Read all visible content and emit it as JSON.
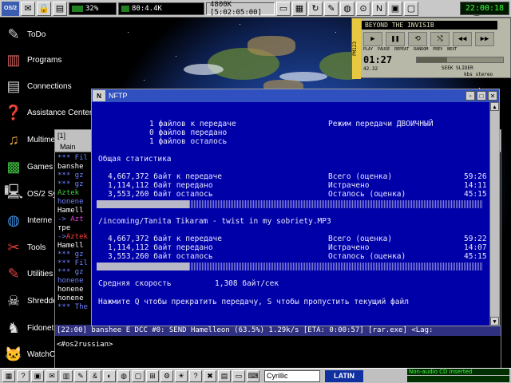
{
  "topbar": {
    "cpu_label": "32%",
    "net_label": "80:4.4K",
    "mem_label": "4800K [5:02:05:00]",
    "clock": "22:00:18"
  },
  "desktop_icons": [
    {
      "label": "ToDo",
      "icon": "todo-icon"
    },
    {
      "label": "Programs",
      "icon": "programs-icon"
    },
    {
      "label": "Connections",
      "icon": "connections-icon"
    },
    {
      "label": "Assistance Center",
      "icon": "assistance-icon"
    },
    {
      "label": "Multime",
      "icon": "multimedia-icon"
    },
    {
      "label": "Games",
      "icon": "games-icon"
    },
    {
      "label": "OS/2 Sy",
      "icon": "os2-system-icon"
    },
    {
      "label": "Interne",
      "icon": "internet-icon"
    },
    {
      "label": "Tools",
      "icon": "tools-icon"
    },
    {
      "label": "Utilities",
      "icon": "utilities-icon"
    },
    {
      "label": "Shredde",
      "icon": "shredder-icon"
    },
    {
      "label": "Fidonet",
      "icon": "fidonet-icon"
    },
    {
      "label": "WatchCat",
      "icon": "watchcat-icon"
    }
  ],
  "player": {
    "title": "BEYOND THE INVISIB",
    "side_tag": "PM123",
    "controls": [
      "▶",
      "❚❚",
      "⟲",
      "⤭",
      "◀◀",
      "▶▶"
    ],
    "control_labels": [
      "PLAY",
      "PAUSE",
      "REPEAT",
      "RANDOM",
      "PREV",
      "NEXT"
    ],
    "time": "01:27",
    "sub": "42.32",
    "seek_label": "SEEK SLIDER",
    "kbs_label": "kbs   stereo",
    "progress": 0.35
  },
  "irc": {
    "title": "[1]",
    "menu": "Main",
    "lines": [
      {
        "prefix": "***",
        "text": " Fil",
        "color": "c-blue"
      },
      {
        "prefix": "",
        "text": "banshe",
        "color": "c-white"
      },
      {
        "prefix": "***",
        "text": "  gz",
        "color": "c-blue"
      },
      {
        "prefix": "***",
        "text": "  gz",
        "color": "c-blue"
      },
      {
        "prefix": "",
        "text": "Aztek",
        "color": "c-green"
      },
      {
        "prefix": "",
        "text": "honene",
        "color": "c-blue"
      },
      {
        "prefix": "",
        "text": "Hamell",
        "color": "c-white"
      },
      {
        "prefix": "->",
        "text": "  Azt",
        "color": "c-mag"
      },
      {
        "prefix": "",
        "text": "   тре",
        "color": "c-white"
      },
      {
        "prefix": "->",
        "text": "Aztek",
        "color": "c-red"
      },
      {
        "prefix": "",
        "text": "Hamell",
        "color": "c-white"
      },
      {
        "prefix": "***",
        "text": "  gz",
        "color": "c-blue"
      },
      {
        "prefix": "***",
        "text": " Fil",
        "color": "c-blue"
      },
      {
        "prefix": "***",
        "text": "  gz",
        "color": "c-blue"
      },
      {
        "prefix": "",
        "text": "honene",
        "color": "c-blue"
      },
      {
        "prefix": "",
        "text": "honene",
        "color": "c-white"
      },
      {
        "prefix": "",
        "text": "honene",
        "color": "c-white"
      },
      {
        "prefix": "***",
        "text": " The",
        "color": "c-blue"
      }
    ],
    "status": "[22:00] banshee E DCC #0: SEND Hamelleon (63.5%) 1.29k/s [ETA: 0:00:57] [rar.exe] <Lag:",
    "input": "<#os2russian>"
  },
  "nftp": {
    "title": "NFTP",
    "files_to_transfer": "1 файлов к передаче",
    "files_transferred": "0 файлов передано",
    "files_left": "1 файлов осталось",
    "mode": "Режим передачи ДВОИЧНЫЙ",
    "overall_title": "Общая статистика",
    "overall": [
      {
        "left": "4,667,372 байт к передаче",
        "mid": "Всего (оценка)",
        "right": "59:26"
      },
      {
        "left": "1,114,112 байт передано",
        "mid": "Истрачено",
        "right": "14:11"
      },
      {
        "left": "3,553,260 байт осталось",
        "mid": "Осталось (оценка)",
        "right": "45:15"
      }
    ],
    "overall_progress": 0.24,
    "file_path": "/incoming/Tanita Tikaram - twist in my sobriety.MP3",
    "file": [
      {
        "left": "4,667,372 байт к передаче",
        "mid": "Всего (оценка)",
        "right": "59:22"
      },
      {
        "left": "1,114,112 байт передано",
        "mid": "Истрачено",
        "right": "14:07"
      },
      {
        "left": "3,553,260 байт осталось",
        "mid": "Осталось (оценка)",
        "right": "45:15"
      }
    ],
    "file_progress": 0.24,
    "speed_label": "Средняя скорость",
    "speed_value": "1,308 байт/сек",
    "hint": "Нажмите Q чтобы прекратить передачу, S чтобы пропустить текущий файл"
  },
  "taskbar": {
    "language": "Cyrillic",
    "latin": "LATIN",
    "cd_status": "Non-audio CD inserted"
  }
}
